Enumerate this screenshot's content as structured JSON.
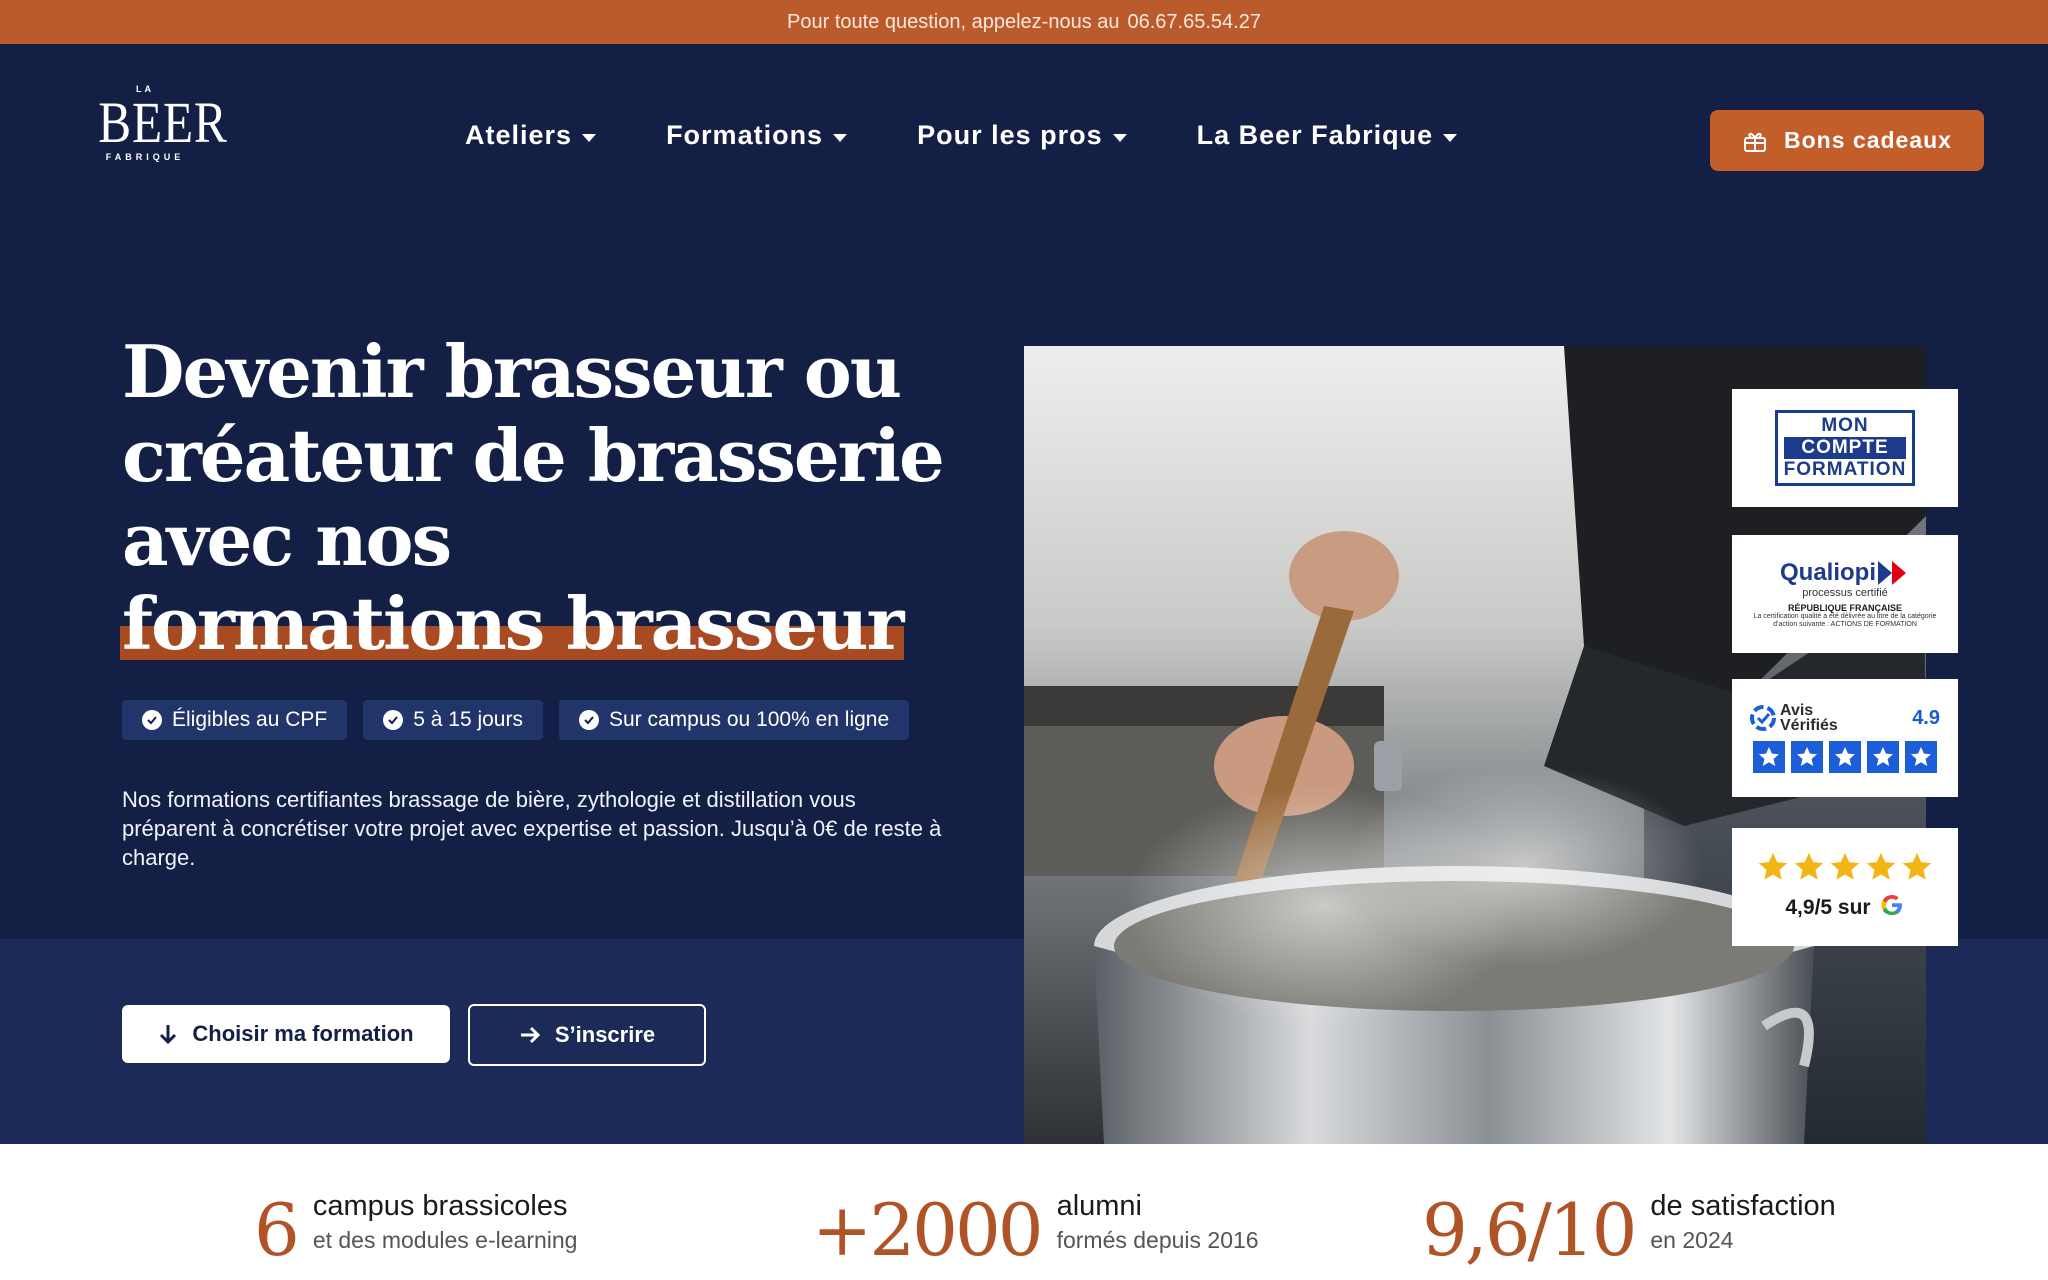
{
  "topbar": {
    "text": "Pour toute question, appelez-nous au",
    "phone": "06.67.65.54.27"
  },
  "logo": {
    "la": "LA",
    "beer": "BEER",
    "fabrique": "FABRIQUE"
  },
  "nav": {
    "items": [
      {
        "label": "Ateliers"
      },
      {
        "label": "Formations"
      },
      {
        "label": "Pour les pros"
      },
      {
        "label": "La Beer Fabrique"
      }
    ]
  },
  "gift_button": {
    "label": "Bons cadeaux",
    "icon": "gift-icon"
  },
  "hero": {
    "title_line1": "Devenir brasseur ou",
    "title_line2": "créateur de brasserie",
    "title_line3": "avec nos",
    "title_highlight": "formations brasseur",
    "highlight_color": "#a84b22",
    "badges": [
      {
        "label": "Éligibles au CPF",
        "icon": "check-circle-icon"
      },
      {
        "label": "5 à 15 jours",
        "icon": "check-circle-icon"
      },
      {
        "label": "Sur campus ou 100% en ligne",
        "icon": "check-circle-icon"
      }
    ],
    "description": "Nos formations certifiantes brassage de bière, zythologie et distillation vous préparent à concrétiser votre projet avec expertise et passion. Jusqu’à 0€ de reste à charge.",
    "cta_primary": {
      "label": "Choisir ma formation",
      "icon": "arrow-down-icon"
    },
    "cta_secondary": {
      "label": "S’inscrire",
      "icon": "arrow-right-icon"
    }
  },
  "certifications": {
    "mon_compte_formation": {
      "line1": "MON",
      "line2": "COMPTE",
      "line3": "FORMATION"
    },
    "qualiopi": {
      "name": "Qualiopi",
      "tagline": "processus certifié",
      "republic": "RÉPUBLIQUE FRANÇAISE",
      "note": "La certification qualité a été délivrée au titre de la catégorie d’action suivante : ACTIONS DE FORMATION"
    },
    "avis_verifies": {
      "label_line1": "Avis",
      "label_line2": "Vérifiés",
      "score": "4.9",
      "stars": 5
    },
    "google": {
      "score_text": "4,9/5 sur",
      "g": "G",
      "stars": 5
    }
  },
  "stats": [
    {
      "number": "6",
      "line1": "campus brassicoles",
      "line2": "et des modules e-learning"
    },
    {
      "number": "+2000",
      "line1": "alumni",
      "line2": "formés depuis 2016"
    },
    {
      "number": "9,6/10",
      "line1": "de satisfaction",
      "line2": "en 2024"
    }
  ],
  "colors": {
    "topbar": "#bb5a2b",
    "navy": "#141f45",
    "navy_band": "#1b2a57",
    "accent": "#c35d2a",
    "stat_number": "#b05427"
  }
}
